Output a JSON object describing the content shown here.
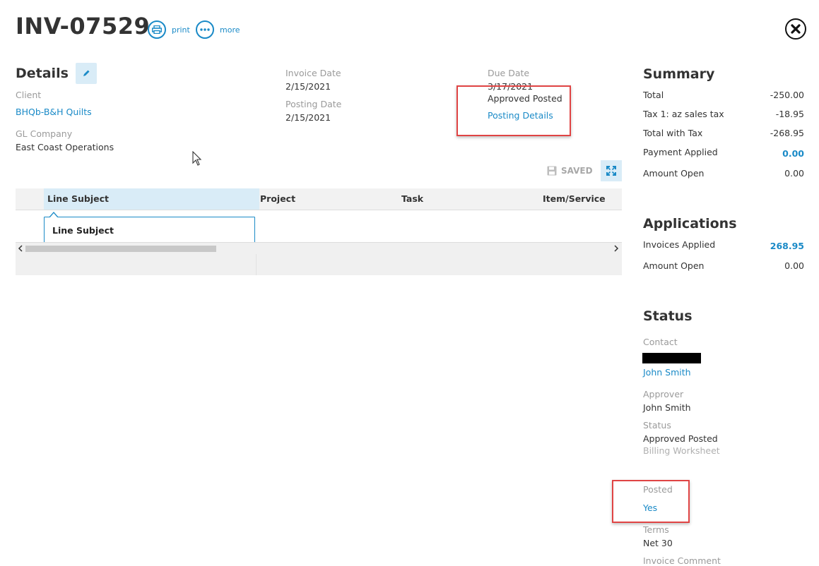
{
  "header": {
    "invoice_number": "INV-07529",
    "print_label": "print",
    "more_label": "more"
  },
  "details": {
    "heading": "Details",
    "client_label": "Client",
    "client_value": "BHQb-B&H Quilts",
    "gl_company_label": "GL Company",
    "gl_company_value": "East Coast Operations",
    "invoice_date_label": "Invoice Date",
    "invoice_date_value": "2/15/2021",
    "posting_date_label": "Posting Date",
    "posting_date_value": "2/15/2021",
    "due_date_label": "Due Date",
    "due_date_value": "3/17/2021",
    "approval_status": "Approved Posted",
    "posting_details_link": "Posting Details"
  },
  "grid": {
    "saved_label": "SAVED",
    "columns": [
      "Line Subject",
      "Project",
      "Task",
      "Item/Service"
    ],
    "tooltip": "Line Subject"
  },
  "summary": {
    "heading": "Summary",
    "rows": [
      {
        "label": "Total",
        "value": "-250.00"
      },
      {
        "label": "Tax 1: az sales tax",
        "value": "-18.95"
      },
      {
        "label": "Total with Tax",
        "value": "-268.95"
      },
      {
        "label": "Payment Applied",
        "value": "0.00"
      },
      {
        "label": "Amount Open",
        "value": "0.00"
      }
    ]
  },
  "applications": {
    "heading": "Applications",
    "rows": [
      {
        "label": "Invoices Applied",
        "value": "268.95"
      },
      {
        "label": "Amount Open",
        "value": "0.00"
      }
    ]
  },
  "status": {
    "heading": "Status",
    "contact_label": "Contact",
    "contact_value": "John Smith",
    "approver_label": "Approver",
    "approver_value": "John Smith",
    "status_label": "Status",
    "status_value": "Approved Posted",
    "status_sub": "Billing Worksheet",
    "posted_label": "Posted",
    "posted_value": "Yes",
    "terms_label": "Terms",
    "terms_value": "Net 30",
    "invoice_comment_label": "Invoice Comment"
  },
  "colors": {
    "accent": "#1a8ac7",
    "highlight_box": "#e04444",
    "button_bg": "#d9ecf7"
  }
}
